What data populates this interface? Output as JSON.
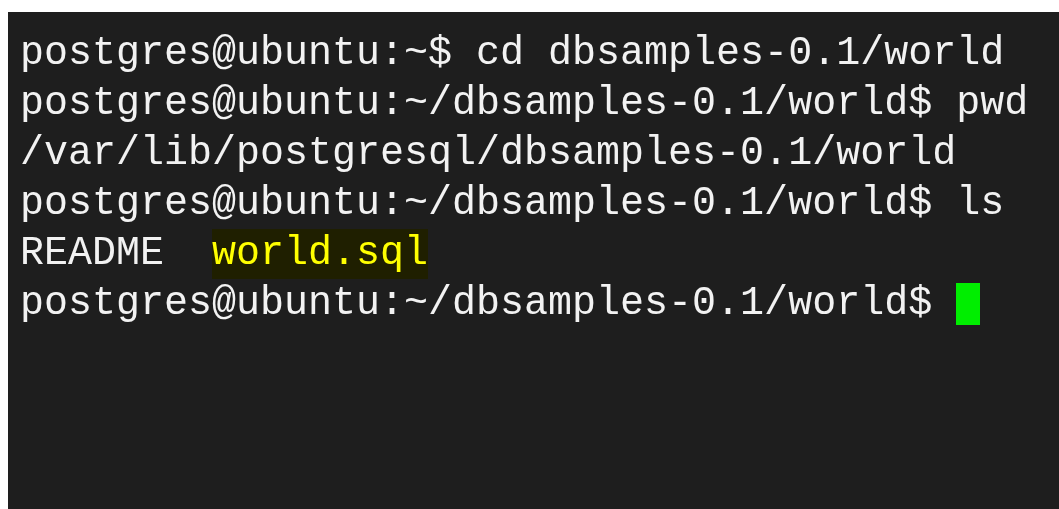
{
  "terminal": {
    "lines": [
      {
        "kind": "text",
        "text": "postgres@ubuntu:~$ cd dbsamples-0.1/world"
      },
      {
        "kind": "text",
        "text": "postgres@ubuntu:~/dbsamples-0.1/world$ pwd"
      },
      {
        "kind": "text",
        "text": "/var/lib/postgresql/dbsamples-0.1/world"
      },
      {
        "kind": "text",
        "text": "postgres@ubuntu:~/dbsamples-0.1/world$ ls"
      },
      {
        "kind": "listing",
        "entries": [
          {
            "name": "README",
            "highlighted": false
          },
          {
            "name": "world.sql",
            "highlighted": true
          }
        ]
      },
      {
        "kind": "prompt",
        "text": "postgres@ubuntu:~/dbsamples-0.1/world$",
        "cursor": true
      }
    ]
  }
}
